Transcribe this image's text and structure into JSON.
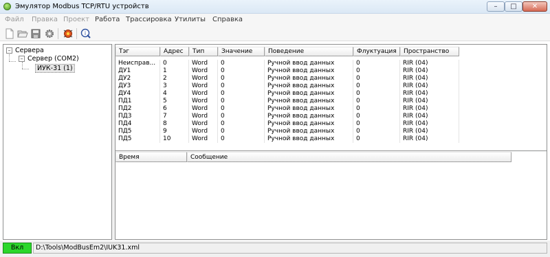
{
  "window": {
    "title": "Эмулятор Modbus TCP/RTU устройств",
    "icon": "app-circle-icon",
    "buttons": {
      "minimize": "–",
      "maximize": "□",
      "close": "✕"
    }
  },
  "menu": {
    "items": [
      {
        "label": "Файл",
        "enabled": false
      },
      {
        "label": "Правка",
        "enabled": false
      },
      {
        "label": "Проект",
        "enabled": false
      },
      {
        "label": "Работа",
        "enabled": true
      },
      {
        "label": "Трассировка",
        "enabled": true
      },
      {
        "label": "Утилиты",
        "enabled": true
      },
      {
        "label": "Справка",
        "enabled": true
      }
    ]
  },
  "toolbar": {
    "buttons": [
      "new-file-icon",
      "open-folder-icon",
      "save-icon",
      "settings-gear-icon",
      "run-bug-icon",
      "help-icon"
    ]
  },
  "tree": {
    "root": {
      "label": "Сервера",
      "expander": "–"
    },
    "server": {
      "label": "Сервер (COM2)",
      "expander": "–"
    },
    "device": {
      "label": "ИУК-31 (1)"
    }
  },
  "grid": {
    "columns": [
      "Тэг",
      "Адрес",
      "Тип",
      "Значение",
      "Поведение",
      "Флуктуация",
      "Пространство"
    ],
    "rows": [
      [
        "Неисправ...",
        "0",
        "Word",
        "0",
        "Ручной ввод данных",
        "0",
        "RIR (04)"
      ],
      [
        "ДУ1",
        "1",
        "Word",
        "0",
        "Ручной ввод данных",
        "0",
        "RIR (04)"
      ],
      [
        "ДУ2",
        "2",
        "Word",
        "0",
        "Ручной ввод данных",
        "0",
        "RIR (04)"
      ],
      [
        "ДУ3",
        "3",
        "Word",
        "0",
        "Ручной ввод данных",
        "0",
        "RIR (04)"
      ],
      [
        "ДУ4",
        "4",
        "Word",
        "0",
        "Ручной ввод данных",
        "0",
        "RIR (04)"
      ],
      [
        "ПД1",
        "5",
        "Word",
        "0",
        "Ручной ввод данных",
        "0",
        "RIR (04)"
      ],
      [
        "ПД2",
        "6",
        "Word",
        "0",
        "Ручной ввод данных",
        "0",
        "RIR (04)"
      ],
      [
        "ПД3",
        "7",
        "Word",
        "0",
        "Ручной ввод данных",
        "0",
        "RIR (04)"
      ],
      [
        "ПД4",
        "8",
        "Word",
        "0",
        "Ручной ввод данных",
        "0",
        "RIR (04)"
      ],
      [
        "ПД5",
        "9",
        "Word",
        "0",
        "Ручной ввод данных",
        "0",
        "RIR (04)"
      ],
      [
        "ПД5",
        "10",
        "Word",
        "0",
        "Ручной ввод данных",
        "0",
        "RIR (04)"
      ]
    ]
  },
  "log": {
    "columns": [
      "Время",
      "Сообщение"
    ]
  },
  "status": {
    "state": "Вкл",
    "state_color": "#2bd72b",
    "file_path": "D:\\Tools\\ModBusEm2\\IUK31.xml"
  }
}
